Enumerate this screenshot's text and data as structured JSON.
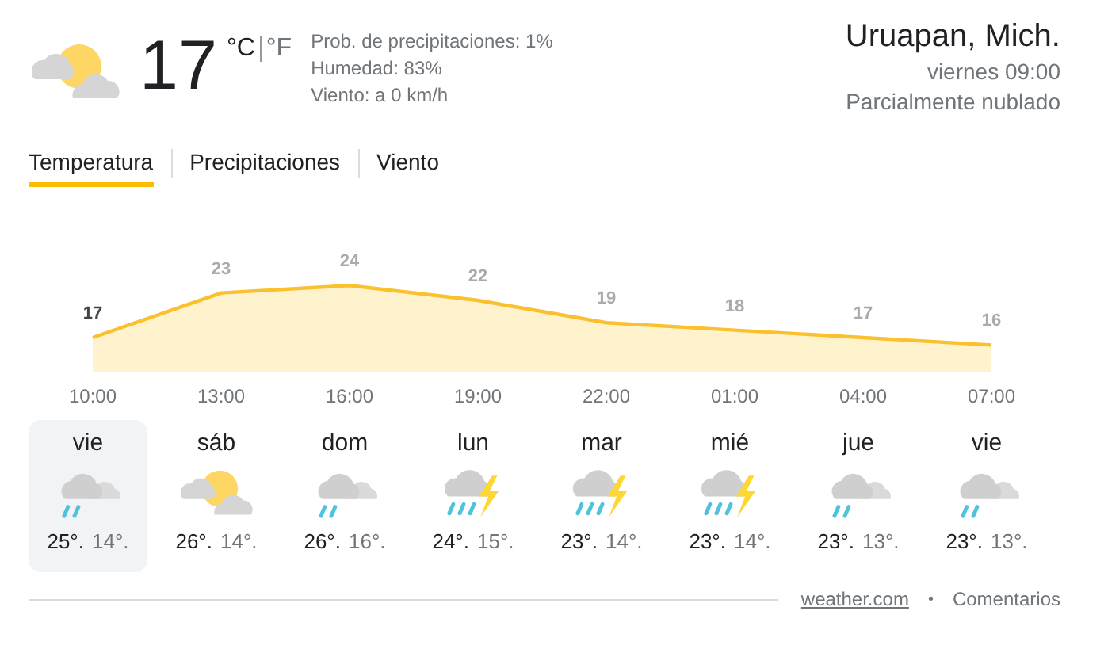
{
  "current": {
    "kind": "sun-cloud",
    "temperature": "17",
    "unit_c": "°C",
    "unit_f": "°F",
    "precipitation": "Prob. de precipitaciones: 1%",
    "humidity": "Humedad: 83%",
    "wind": "Viento: a 0 km/h"
  },
  "location": {
    "name": "Uruapan, Mich.",
    "time": "viernes 09:00",
    "condition": "Parcialmente nublado"
  },
  "tabs": [
    {
      "label": "Temperatura",
      "selected": true
    },
    {
      "label": "Precipitaciones",
      "selected": false
    },
    {
      "label": "Viento",
      "selected": false
    }
  ],
  "chart_data": {
    "type": "area",
    "categories": [
      "10:00",
      "13:00",
      "16:00",
      "19:00",
      "22:00",
      "01:00",
      "04:00",
      "07:00"
    ],
    "values": [
      17,
      23,
      24,
      22,
      19,
      18,
      17,
      16
    ],
    "data_labels": true
  },
  "days": [
    {
      "day": "vie",
      "kind": "rain",
      "high": "25°.",
      "low": "14°.",
      "selected": true
    },
    {
      "day": "sáb",
      "kind": "sun-cloud",
      "high": "26°.",
      "low": "14°.",
      "selected": false
    },
    {
      "day": "dom",
      "kind": "rain",
      "high": "26°.",
      "low": "16°.",
      "selected": false
    },
    {
      "day": "lun",
      "kind": "storm",
      "high": "24°.",
      "low": "15°.",
      "selected": false
    },
    {
      "day": "mar",
      "kind": "storm",
      "high": "23°.",
      "low": "14°.",
      "selected": false
    },
    {
      "day": "mié",
      "kind": "storm",
      "high": "23°.",
      "low": "14°.",
      "selected": false
    },
    {
      "day": "jue",
      "kind": "rain",
      "high": "23°.",
      "low": "13°.",
      "selected": false
    },
    {
      "day": "vie",
      "kind": "rain",
      "high": "23°.",
      "low": "13°.",
      "selected": false
    }
  ],
  "footer": {
    "source": "weather.com",
    "separator": "•",
    "feedback": "Comentarios"
  }
}
